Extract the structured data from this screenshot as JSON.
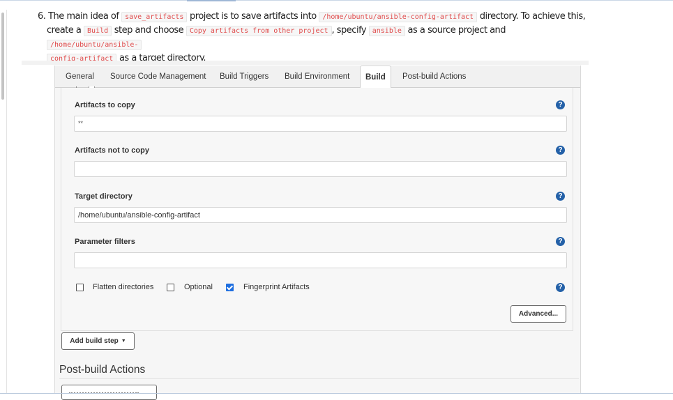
{
  "instruction": {
    "number": "6.",
    "t1": "The main idea of",
    "c1": "save_artifacts",
    "t2": "project is to save artifacts into",
    "c2": "/home/ubuntu/ansible-config-artifact",
    "t3": "directory. To achieve this,",
    "t4": "create a",
    "c3": "Build",
    "t5": "step and choose",
    "c4": "Copy artifacts from other project",
    "t6": ", specify",
    "c5": "ansible",
    "t7": "as a source project and",
    "c6a": "/home/ubuntu/ansible-",
    "c6b": "config-artifact",
    "t8": "as a target directory."
  },
  "tabs": [
    {
      "label": "General"
    },
    {
      "label": "Source Code Management"
    },
    {
      "label": "Build Triggers"
    },
    {
      "label": "Build Environment"
    },
    {
      "label": "Build",
      "active": true
    },
    {
      "label": "Post-build Actions"
    }
  ],
  "form": {
    "artifacts_to_copy": {
      "label": "Artifacts to copy",
      "value": "**"
    },
    "artifacts_not_to_copy": {
      "label": "Artifacts not to copy",
      "value": ""
    },
    "target_directory": {
      "label": "Target directory",
      "value": "/home/ubuntu/ansible-config-artifact"
    },
    "parameter_filters": {
      "label": "Parameter filters",
      "value": ""
    },
    "help_glyph": "?",
    "checkboxes": [
      {
        "label": "Flatten directories",
        "checked": false
      },
      {
        "label": "Optional",
        "checked": false
      },
      {
        "label": "Fingerprint Artifacts",
        "checked": true
      }
    ],
    "advanced_button": "Advanced...",
    "add_build_step_button": "Add build step",
    "caret": "▼"
  },
  "post_build": {
    "title": "Post-build Actions"
  },
  "colors": {
    "help_icon": "#2461a8",
    "checkbox_checked": "#1f6fe0",
    "code_text": "#e04b4b"
  }
}
